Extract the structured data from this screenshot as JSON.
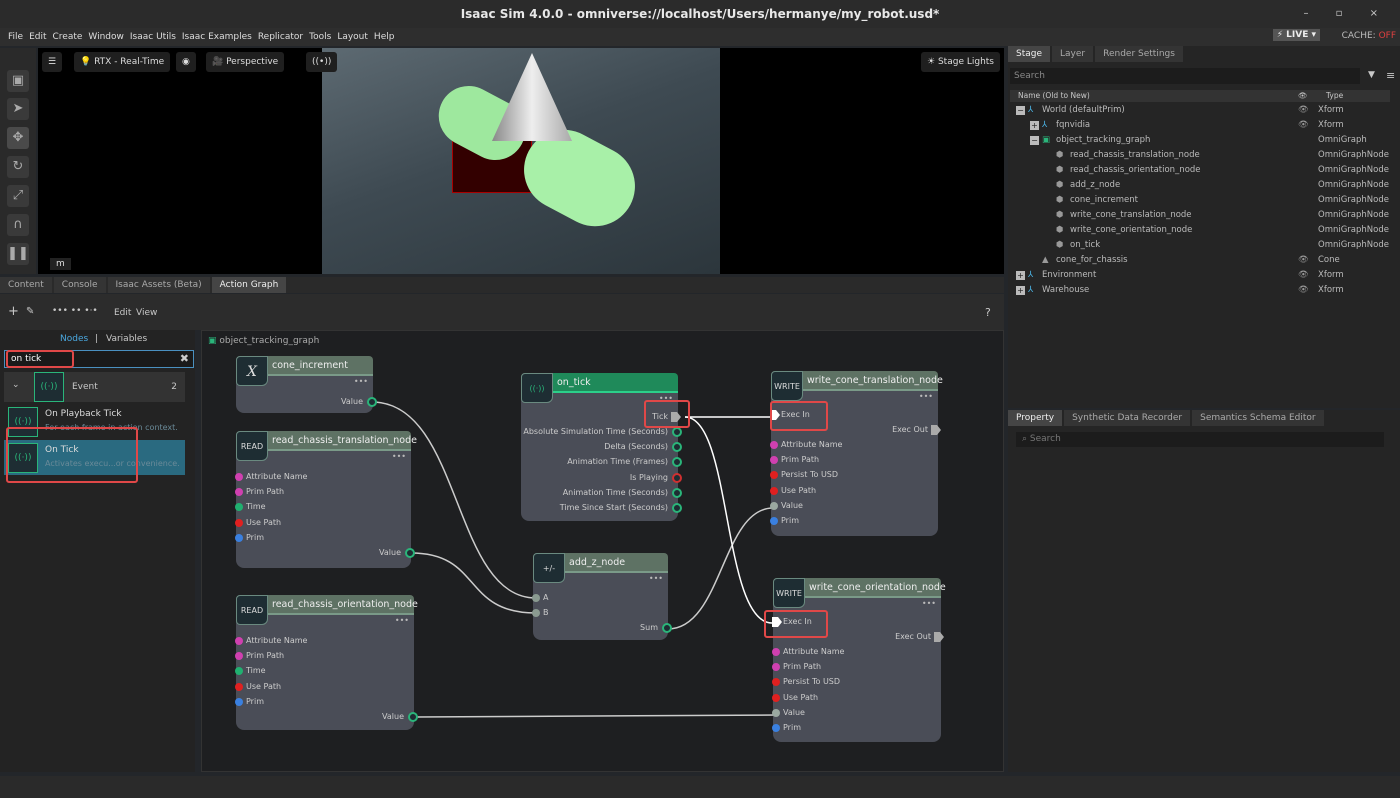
{
  "window": {
    "title": "Isaac Sim 4.0.0 - omniverse://localhost/Users/hermanye/my_robot.usd*",
    "controls": "– ▫ ×"
  },
  "menu": [
    "File",
    "Edit",
    "Create",
    "Window",
    "Isaac Utils",
    "Isaac Examples",
    "Replicator",
    "Tools",
    "Layout",
    "Help"
  ],
  "status": {
    "live": "LIVE",
    "cache_label": "CACHE:",
    "cache_value": "OFF"
  },
  "viewport": {
    "renderer": "RTX - Real-Time",
    "camera": "Perspective",
    "stage_lights": "Stage Lights",
    "unit": "m"
  },
  "bottom_tabs": [
    "Content",
    "Console",
    "Isaac Assets (Beta)",
    "Action Graph"
  ],
  "active_bottom_tab": "Action Graph",
  "action_graph": {
    "toolbar": {
      "edit": "Edit",
      "view": "View",
      "help": "?"
    },
    "panel_tabs": {
      "nodes": "Nodes",
      "sep": "|",
      "variables": "Variables"
    },
    "search_value": "on tick",
    "category": {
      "name": "Event",
      "count": "2"
    },
    "results": [
      {
        "title": "On Playback Tick",
        "desc": "For each frame in action context."
      },
      {
        "title": "On Tick",
        "desc": "Activates execu...or convenience."
      }
    ],
    "graph_name": "object_tracking_graph",
    "nodes": {
      "cone_increment": {
        "title": "cone_increment",
        "icon": "X",
        "inputs": [],
        "outputs": [
          "Value"
        ]
      },
      "read_trans": {
        "title": "read_chassis_translation_node",
        "icon": "READ",
        "inputs": [
          {
            "l": "Attribute Name",
            "c": "#d040b0"
          },
          {
            "l": "Prim Path",
            "c": "#d040b0"
          },
          {
            "l": "Time",
            "c": "#20b070"
          },
          {
            "l": "Use Path",
            "c": "#e02020"
          },
          {
            "l": "Prim",
            "c": "#3a80e0"
          }
        ],
        "outputs": [
          "Value"
        ]
      },
      "read_orient": {
        "title": "read_chassis_orientation_node",
        "icon": "READ",
        "inputs": [
          {
            "l": "Attribute Name",
            "c": "#d040b0"
          },
          {
            "l": "Prim Path",
            "c": "#d040b0"
          },
          {
            "l": "Time",
            "c": "#20b070"
          },
          {
            "l": "Use Path",
            "c": "#e02020"
          },
          {
            "l": "Prim",
            "c": "#3a80e0"
          }
        ],
        "outputs": [
          "Value"
        ]
      },
      "on_tick": {
        "title": "on_tick",
        "exec_out": "Tick",
        "outputs": [
          "Absolute Simulation Time (Seconds)",
          "Delta (Seconds)",
          "Animation Time (Frames)",
          "Is Playing",
          "Animation Time (Seconds)",
          "Time Since Start (Seconds)"
        ]
      },
      "add_z": {
        "title": "add_z_node",
        "icon": "+/-",
        "inputs": [
          {
            "l": "A",
            "c": "#8a9a90"
          },
          {
            "l": "B",
            "c": "#8a9a90"
          }
        ],
        "outputs": [
          "Sum"
        ]
      },
      "write_trans": {
        "title": "write_cone_translation_node",
        "icon": "WRITE",
        "exec_in": "Exec In",
        "exec_out": "Exec Out",
        "inputs": [
          {
            "l": "Attribute Name",
            "c": "#d040b0"
          },
          {
            "l": "Prim Path",
            "c": "#d040b0"
          },
          {
            "l": "Persist To USD",
            "c": "#e02020"
          },
          {
            "l": "Use Path",
            "c": "#e02020"
          },
          {
            "l": "Value",
            "c": "#9aa8a0"
          },
          {
            "l": "Prim",
            "c": "#3a80e0"
          }
        ]
      },
      "write_orient": {
        "title": "write_cone_orientation_node",
        "icon": "WRITE",
        "exec_in": "Exec In",
        "exec_out": "Exec Out",
        "inputs": [
          {
            "l": "Attribute Name",
            "c": "#d040b0"
          },
          {
            "l": "Prim Path",
            "c": "#d040b0"
          },
          {
            "l": "Persist To USD",
            "c": "#e02020"
          },
          {
            "l": "Use Path",
            "c": "#e02020"
          },
          {
            "l": "Value",
            "c": "#9aa8a0"
          },
          {
            "l": "Prim",
            "c": "#3a80e0"
          }
        ]
      }
    }
  },
  "stage": {
    "tabs": [
      "Stage",
      "Layer",
      "Render Settings"
    ],
    "search_placeholder": "Search",
    "columns": {
      "name": "Name (Old to New)",
      "type": "Type"
    },
    "rows": [
      {
        "name": "World (defaultPrim)",
        "type": "Xform",
        "level": 0,
        "exp": "−",
        "eye": true
      },
      {
        "name": "fqnvidia",
        "type": "Xform",
        "level": 1,
        "exp": "+",
        "eye": true
      },
      {
        "name": "object_tracking_graph",
        "type": "OmniGraph",
        "level": 1,
        "exp": "−",
        "eye": false
      },
      {
        "name": "read_chassis_translation_node",
        "type": "OmniGraphNode",
        "level": 2,
        "exp": "",
        "eye": false
      },
      {
        "name": "read_chassis_orientation_node",
        "type": "OmniGraphNode",
        "level": 2,
        "exp": "",
        "eye": false
      },
      {
        "name": "add_z_node",
        "type": "OmniGraphNode",
        "level": 2,
        "exp": "",
        "eye": false
      },
      {
        "name": "cone_increment",
        "type": "OmniGraphNode",
        "level": 2,
        "exp": "",
        "eye": false
      },
      {
        "name": "write_cone_translation_node",
        "type": "OmniGraphNode",
        "level": 2,
        "exp": "",
        "eye": false
      },
      {
        "name": "write_cone_orientation_node",
        "type": "OmniGraphNode",
        "level": 2,
        "exp": "",
        "eye": false
      },
      {
        "name": "on_tick",
        "type": "OmniGraphNode",
        "level": 2,
        "exp": "",
        "eye": false
      },
      {
        "name": "cone_for_chassis",
        "type": "Cone",
        "level": 1,
        "exp": "",
        "eye": true
      },
      {
        "name": "Environment",
        "type": "Xform",
        "level": 0,
        "exp": "+",
        "eye": true
      },
      {
        "name": "Warehouse",
        "type": "Xform",
        "level": 0,
        "exp": "+",
        "eye": true
      }
    ]
  },
  "property": {
    "tabs": [
      "Property",
      "Synthetic Data Recorder",
      "Semantics Schema Editor"
    ],
    "search_placeholder": "Search"
  }
}
